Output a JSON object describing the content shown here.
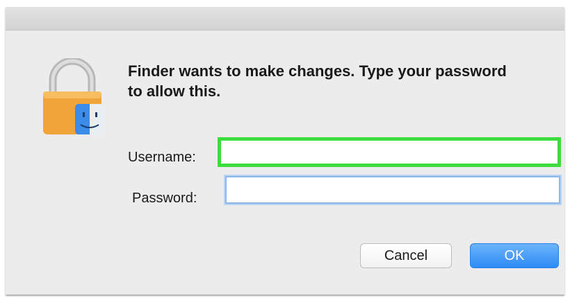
{
  "dialog": {
    "message": "Finder wants to make changes. Type your password to allow this.",
    "icon": "lock-with-finder-icon"
  },
  "form": {
    "username_label": "Username:",
    "username_value": "",
    "password_label": "Password:",
    "password_value": ""
  },
  "buttons": {
    "cancel_label": "Cancel",
    "ok_label": "OK"
  },
  "colors": {
    "highlight_outline": "#3ddc3d",
    "focus_ring": "#8fb7e8",
    "default_button": "#2f8bf5"
  }
}
